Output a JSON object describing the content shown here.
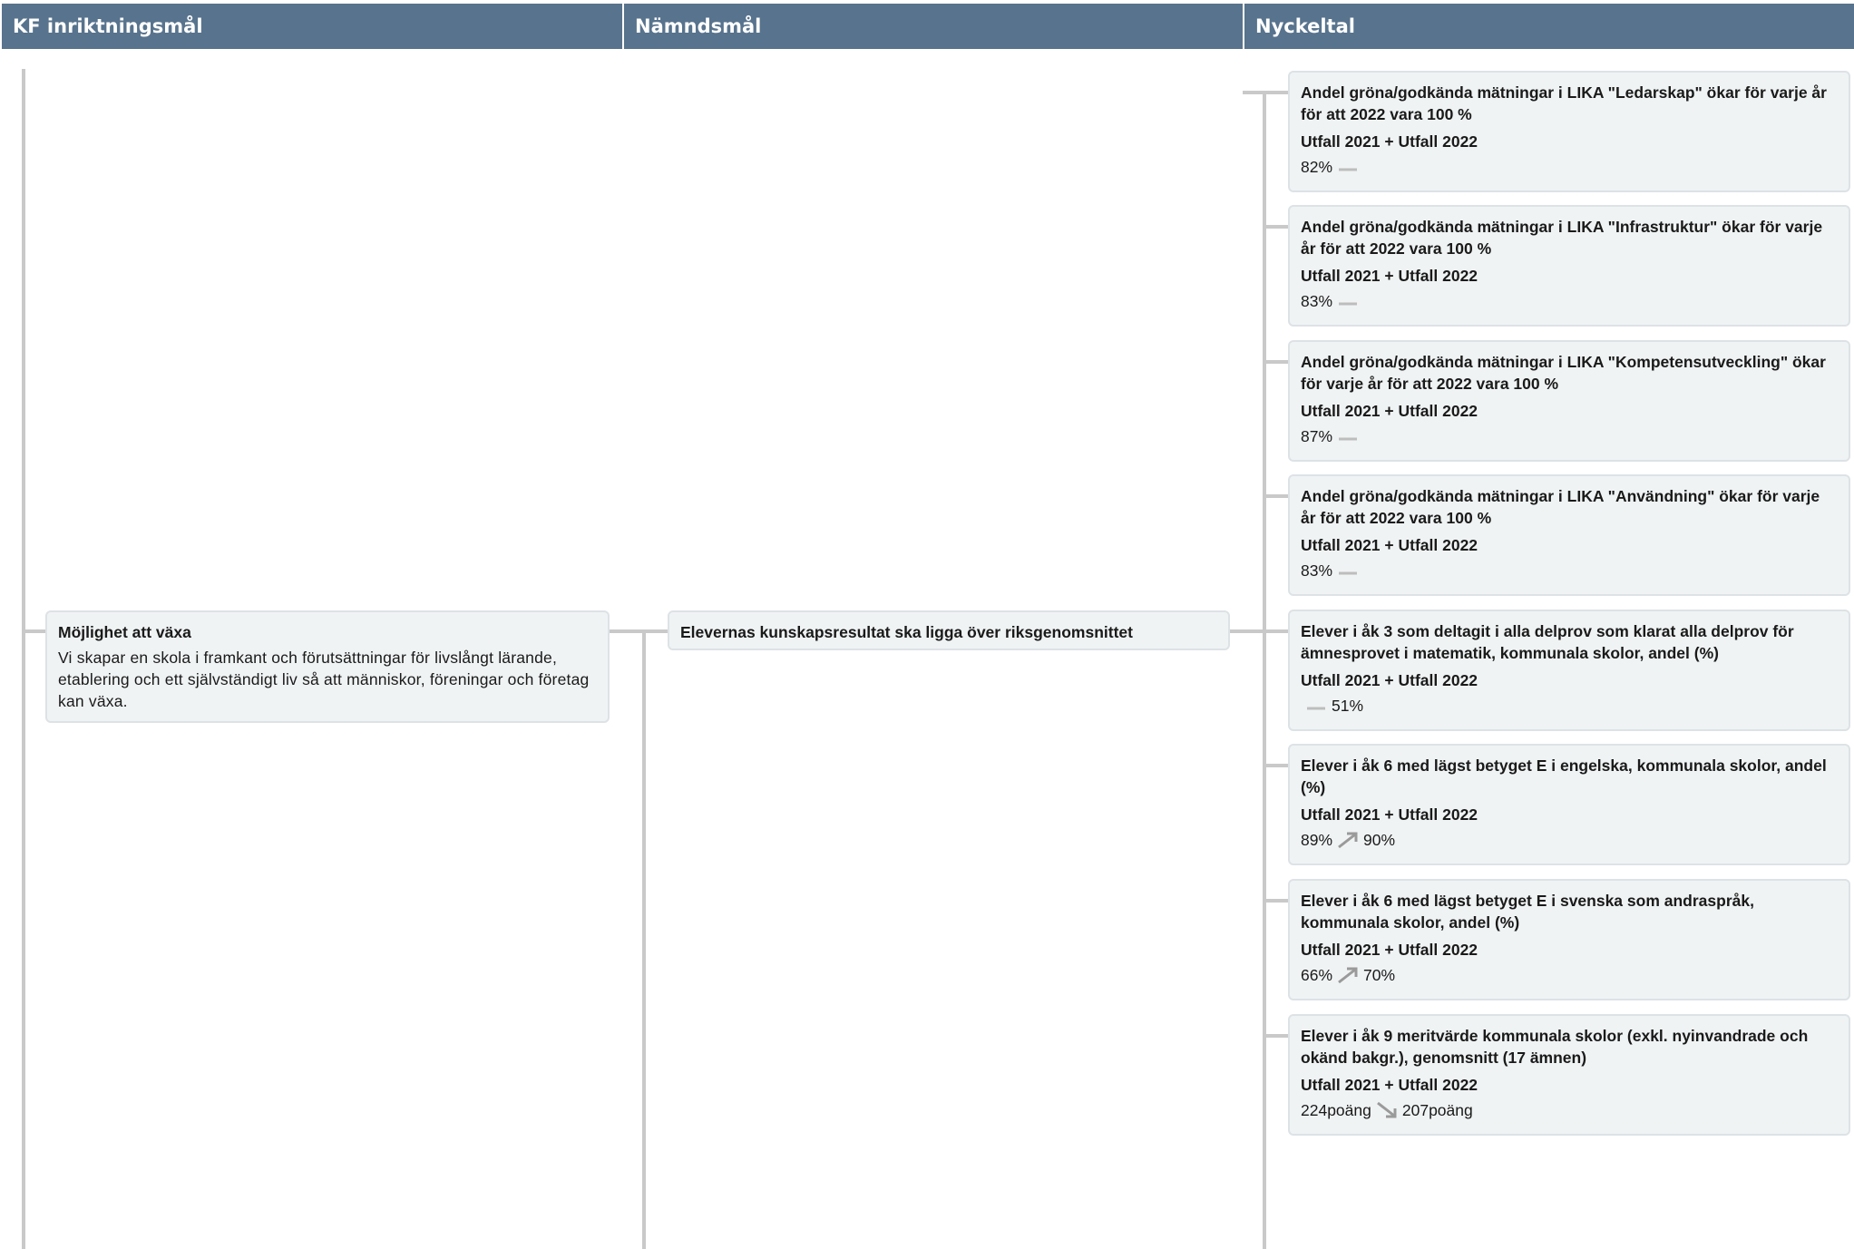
{
  "headers": {
    "col1": "KF inriktningsmål",
    "col2": "Nämndsmål",
    "col3": "Nyckeltal"
  },
  "kf_goal": {
    "title": "Möjlighet att växa",
    "description": "Vi skapar en skola i framkant och förutsättningar för livslångt lärande, etablering och ett självständigt liv så att människor, föreningar och företag kan växa."
  },
  "board_goal": {
    "title": "Elevernas kunskapsresultat ska ligga över riksgenomsnittet"
  },
  "indicators": [
    {
      "title": "Andel gröna/godkända mätningar i LIKA \"Ledarskap\" ökar för varje år för att 2022 vara 100 %",
      "sub": "Utfall 2021 + Utfall 2022",
      "v2021": "82%",
      "trend": "flat",
      "v2022": ""
    },
    {
      "title": "Andel gröna/godkända mätningar i LIKA \"Infrastruktur\" ökar för varje år för att 2022 vara 100 %",
      "sub": "Utfall 2021 + Utfall 2022",
      "v2021": "83%",
      "trend": "flat",
      "v2022": ""
    },
    {
      "title": "Andel gröna/godkända mätningar i LIKA \"Kompetensutveckling\" ökar för varje år för att 2022 vara 100 %",
      "sub": "Utfall 2021 + Utfall 2022",
      "v2021": "87%",
      "trend": "flat",
      "v2022": ""
    },
    {
      "title": "Andel gröna/godkända mätningar i LIKA \"Användning\" ökar för varje år för att 2022 vara 100 %",
      "sub": "Utfall 2021 + Utfall 2022",
      "v2021": "83%",
      "trend": "flat",
      "v2022": ""
    },
    {
      "title": "Elever i åk 3 som deltagit i alla delprov som klarat alla delprov för ämnesprovet i matematik, kommunala skolor, andel (%)",
      "sub": "Utfall 2021 + Utfall 2022",
      "v2021": "",
      "trend": "flat",
      "v2022": "51%"
    },
    {
      "title": "Elever i åk 6 med lägst betyget E  i engelska, kommunala skolor, andel (%)",
      "sub": "Utfall 2021 + Utfall 2022",
      "v2021": "89%",
      "trend": "up",
      "v2022": "90%"
    },
    {
      "title": "Elever i åk 6 med lägst betyget E i svenska som andraspråk, kommunala skolor, andel (%)",
      "sub": "Utfall 2021 + Utfall 2022",
      "v2021": "66%",
      "trend": "up",
      "v2022": "70%"
    },
    {
      "title": "Elever i åk 9 meritvärde kommunala skolor (exkl. nyinvandrade och okänd bakgr.), genomsnitt (17 ämnen)",
      "sub": "Utfall 2021 + Utfall 2022",
      "v2021": "224poäng",
      "trend": "down",
      "v2022": "207poäng"
    }
  ],
  "colors": {
    "header_bg": "#58738d",
    "card_bg": "#f0f3f4",
    "connector": "#c9c9c9",
    "trend_icon": "#9a9a9a"
  }
}
